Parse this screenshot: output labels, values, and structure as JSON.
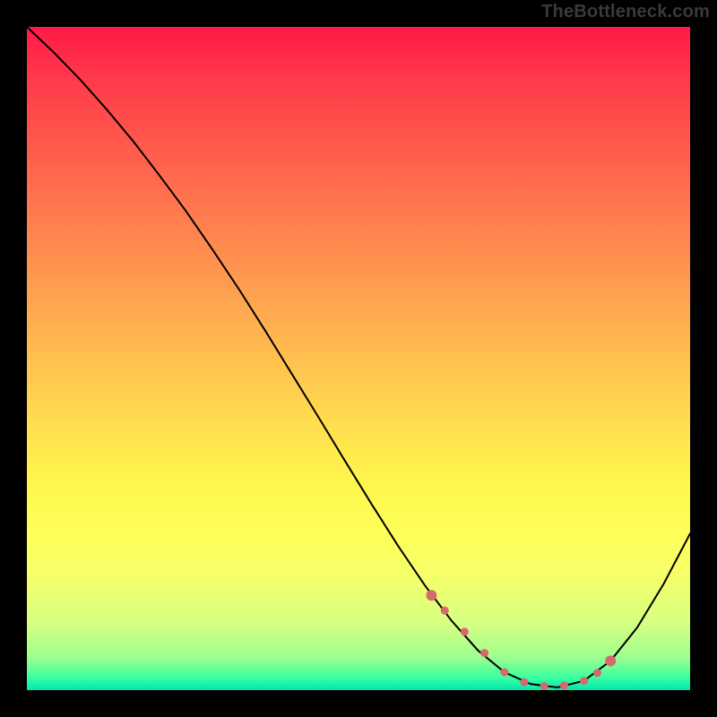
{
  "watermark": "TheBottleneck.com",
  "chart_data": {
    "type": "line",
    "title": "",
    "xlabel": "",
    "ylabel": "",
    "xlim": [
      0,
      100
    ],
    "ylim": [
      0,
      100
    ],
    "series": [
      {
        "name": "curve",
        "x": [
          0,
          4,
          8,
          12,
          16,
          20,
          24,
          28,
          32,
          36,
          40,
          44,
          48,
          52,
          56,
          60,
          64,
          68,
          72,
          76,
          80,
          84,
          88,
          92,
          96,
          100
        ],
        "y": [
          100,
          96.2,
          92.1,
          87.6,
          82.8,
          77.6,
          72.2,
          66.4,
          60.4,
          54.1,
          47.6,
          41.1,
          34.5,
          28.0,
          21.7,
          15.8,
          10.5,
          6.0,
          2.7,
          0.9,
          0.4,
          1.4,
          4.4,
          9.4,
          16.0,
          23.6
        ]
      }
    ],
    "markers": {
      "name": "highlight-points",
      "color": "#d56a6d",
      "x": [
        61,
        63,
        66,
        69,
        72,
        75,
        78,
        81,
        84,
        86,
        88
      ],
      "y": [
        14.3,
        12.0,
        8.8,
        5.6,
        2.7,
        1.2,
        0.6,
        0.7,
        1.4,
        2.6,
        4.4
      ]
    }
  }
}
